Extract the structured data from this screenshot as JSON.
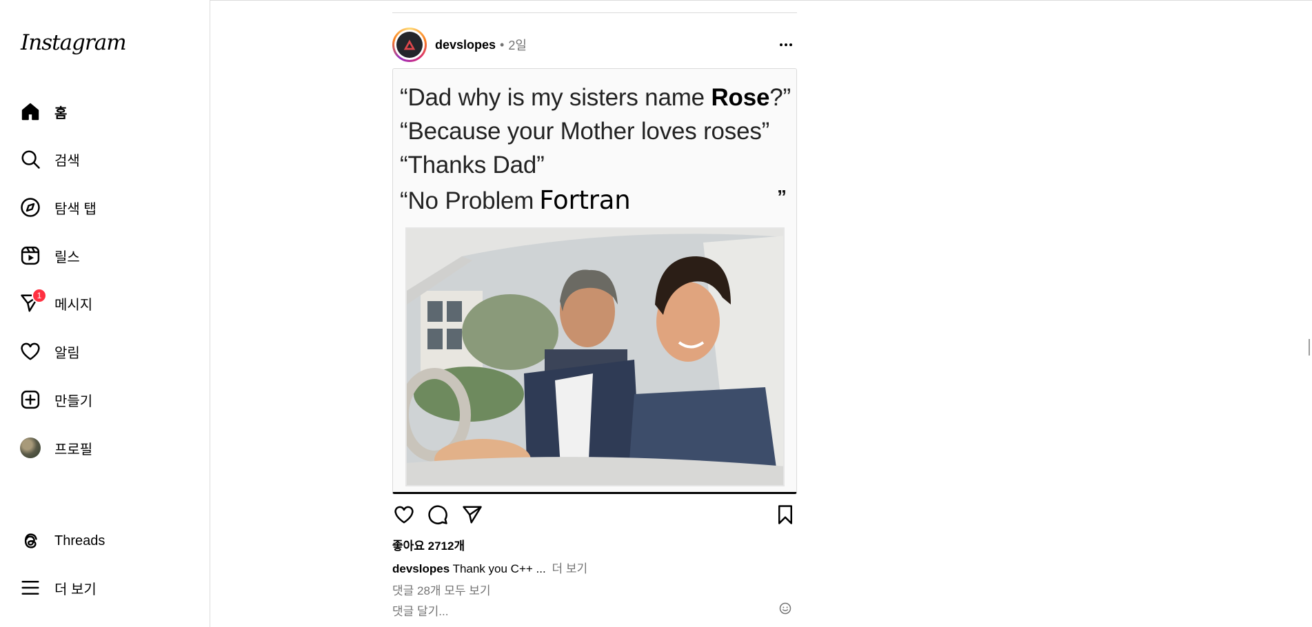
{
  "app": {
    "logo": "Instagram"
  },
  "sidebar": {
    "items": [
      {
        "label": "홈",
        "icon": "home-icon",
        "active": true
      },
      {
        "label": "검색",
        "icon": "search-icon"
      },
      {
        "label": "탐색 탭",
        "icon": "compass-icon"
      },
      {
        "label": "릴스",
        "icon": "reels-icon"
      },
      {
        "label": "메시지",
        "icon": "messages-icon",
        "badge": "1"
      },
      {
        "label": "알림",
        "icon": "heart-icon"
      },
      {
        "label": "만들기",
        "icon": "create-icon"
      },
      {
        "label": "프로필",
        "icon": "profile-avatar"
      }
    ],
    "bottom": [
      {
        "label": "Threads",
        "icon": "threads-icon"
      },
      {
        "label": "더 보기",
        "icon": "menu-icon"
      }
    ]
  },
  "post": {
    "username": "devslopes",
    "dot": "•",
    "time": "2일",
    "meme": {
      "line1_a": "“Dad why is my sisters name ",
      "line1_b": "Rose",
      "line1_c": "?”",
      "line2": "“Because your Mother loves roses”",
      "line3": "“Thanks Dad”",
      "line4_a": "“No Problem",
      "line4_b": "Fortran",
      "line4_end": "”"
    },
    "likes": "좋아요 2712개",
    "caption_user": "devslopes",
    "caption_text": "Thank you C++ ...",
    "caption_more": "더 보기",
    "view_comments": "댓글 28개 모두 보기",
    "comment_placeholder": "댓글 달기..."
  },
  "colors": {
    "badge": "#ff3040",
    "muted": "#737373",
    "border": "#dbdbdb"
  }
}
